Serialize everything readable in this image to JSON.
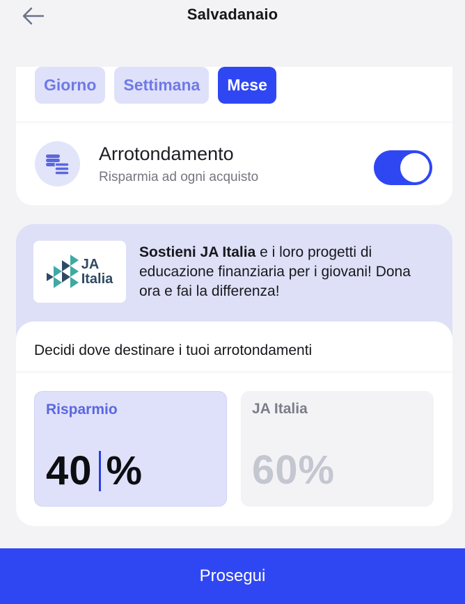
{
  "header": {
    "title": "Salvadanaio",
    "back_icon": "arrow-left-icon"
  },
  "period_tabs": [
    {
      "label": "Giorno",
      "active": false
    },
    {
      "label": "Settimana",
      "active": false
    },
    {
      "label": "Mese",
      "active": true
    }
  ],
  "round_up": {
    "icon": "coins-icon",
    "title": "Arrotondamento",
    "subtitle": "Risparmia ad ogni acquisto",
    "enabled": true
  },
  "donation": {
    "logo_text_line1": "JA",
    "logo_text_line2": "Italia",
    "text_bold": "Sostieni JA Italia",
    "text_rest": " e i loro progetti di educazione finanziaria per i giovani! Dona ora e fai la differenza!"
  },
  "allocation": {
    "title": "Decidi dove destinare i tuoi arrotondamenti",
    "savings": {
      "label": "Risparmio",
      "value": "40",
      "unit": "%"
    },
    "ja": {
      "label": "JA Italia",
      "value": "60%"
    }
  },
  "cta": {
    "label": "Prosegui"
  },
  "colors": {
    "accent": "#2f47f2",
    "accent_light": "#dfe1fa",
    "background": "#f3f3f6"
  }
}
